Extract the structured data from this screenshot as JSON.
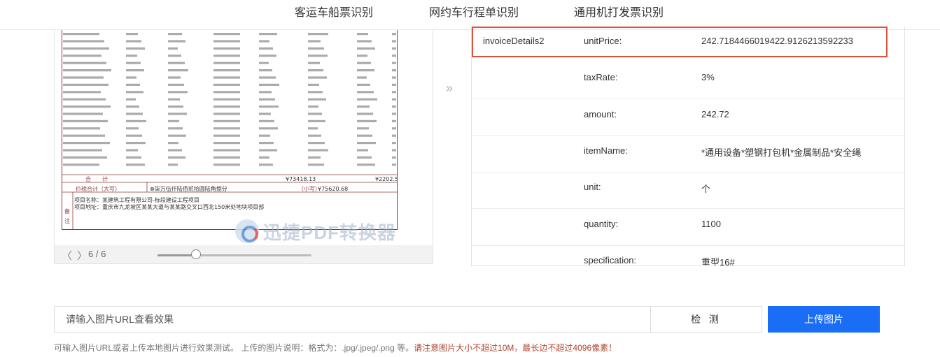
{
  "tabs": [
    "客运车船票识别",
    "网约车行程单识别",
    "通用机打发票识别"
  ],
  "preview": {
    "page_indicator": "6 / 6",
    "slider_level": 0.25,
    "watermark_text": "迅捷PDF转换器",
    "prev_icon": "chevron-left-icon",
    "next_icon": "chevron-right-icon"
  },
  "result": {
    "rows": [
      {
        "key": "invoiceDetails2",
        "field": "unitPrice:",
        "value": "242.7184466019422.9126213592233"
      },
      {
        "key": "",
        "field": "taxRate:",
        "value": "3%"
      },
      {
        "key": "",
        "field": "amount:",
        "value": "242.72"
      },
      {
        "key": "",
        "field": "itemName:",
        "value": "*通用设备*塑钢打包机*金属制品*安全绳"
      },
      {
        "key": "",
        "field": "unit:",
        "value": "个"
      },
      {
        "key": "",
        "field": "quantity:",
        "value": "1100"
      },
      {
        "key": "",
        "field": "specification:",
        "value": "重型16#"
      }
    ]
  },
  "input": {
    "placeholder": "请输入图片URL查看效果"
  },
  "buttons": {
    "detect": "检 测",
    "upload": "上传图片"
  },
  "hint": {
    "normal": "可输入图片URL或者上传本地图片进行效果测试。 上传的图片说明：格式为：.jpg/.jpeg/.png 等。",
    "warning": "请注意图片大小不超过10M，最长边不超过4096像素！"
  },
  "colors": {
    "accent": "#1a6df5",
    "highlight": "#e04f3a",
    "warning": "#b0442f"
  }
}
